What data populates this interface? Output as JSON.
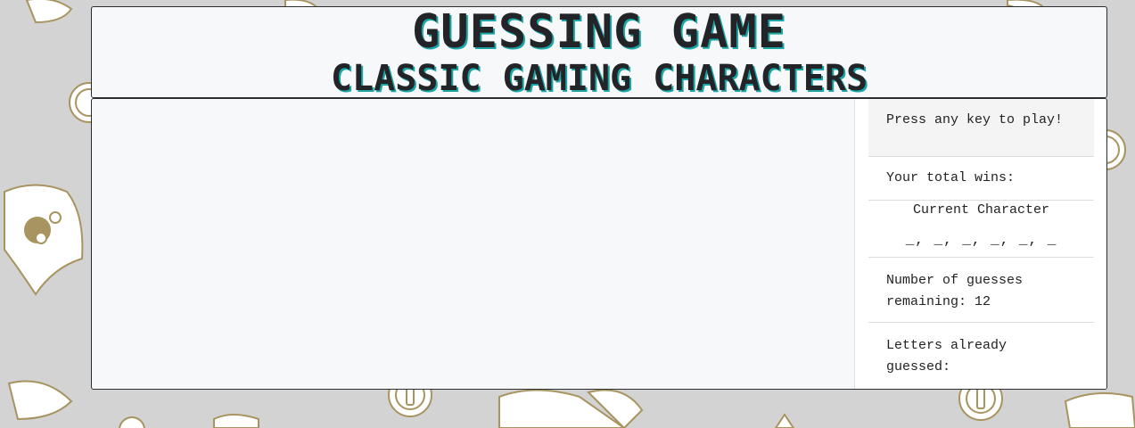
{
  "header": {
    "title": "Guessing Game",
    "subtitle": "Classic Gaming Characters"
  },
  "panel": {
    "prompt": "Press any key to play!",
    "wins_label": "Your total wins:",
    "current_character_label": "Current Character",
    "word_blanks": "_, _, _, _, _, _",
    "guesses_label": "Number of guesses remaining:",
    "guesses_remaining": "12",
    "letters_guessed_label": "Letters already guessed:"
  },
  "colors": {
    "background": "#d3d3d3",
    "card": "#f7f8fa",
    "title_text": "#222428",
    "title_shadow": "#1aa6a6",
    "pattern_stroke": "#a89460"
  },
  "icons": {
    "background_pattern": "coin-and-rocket-pattern"
  }
}
